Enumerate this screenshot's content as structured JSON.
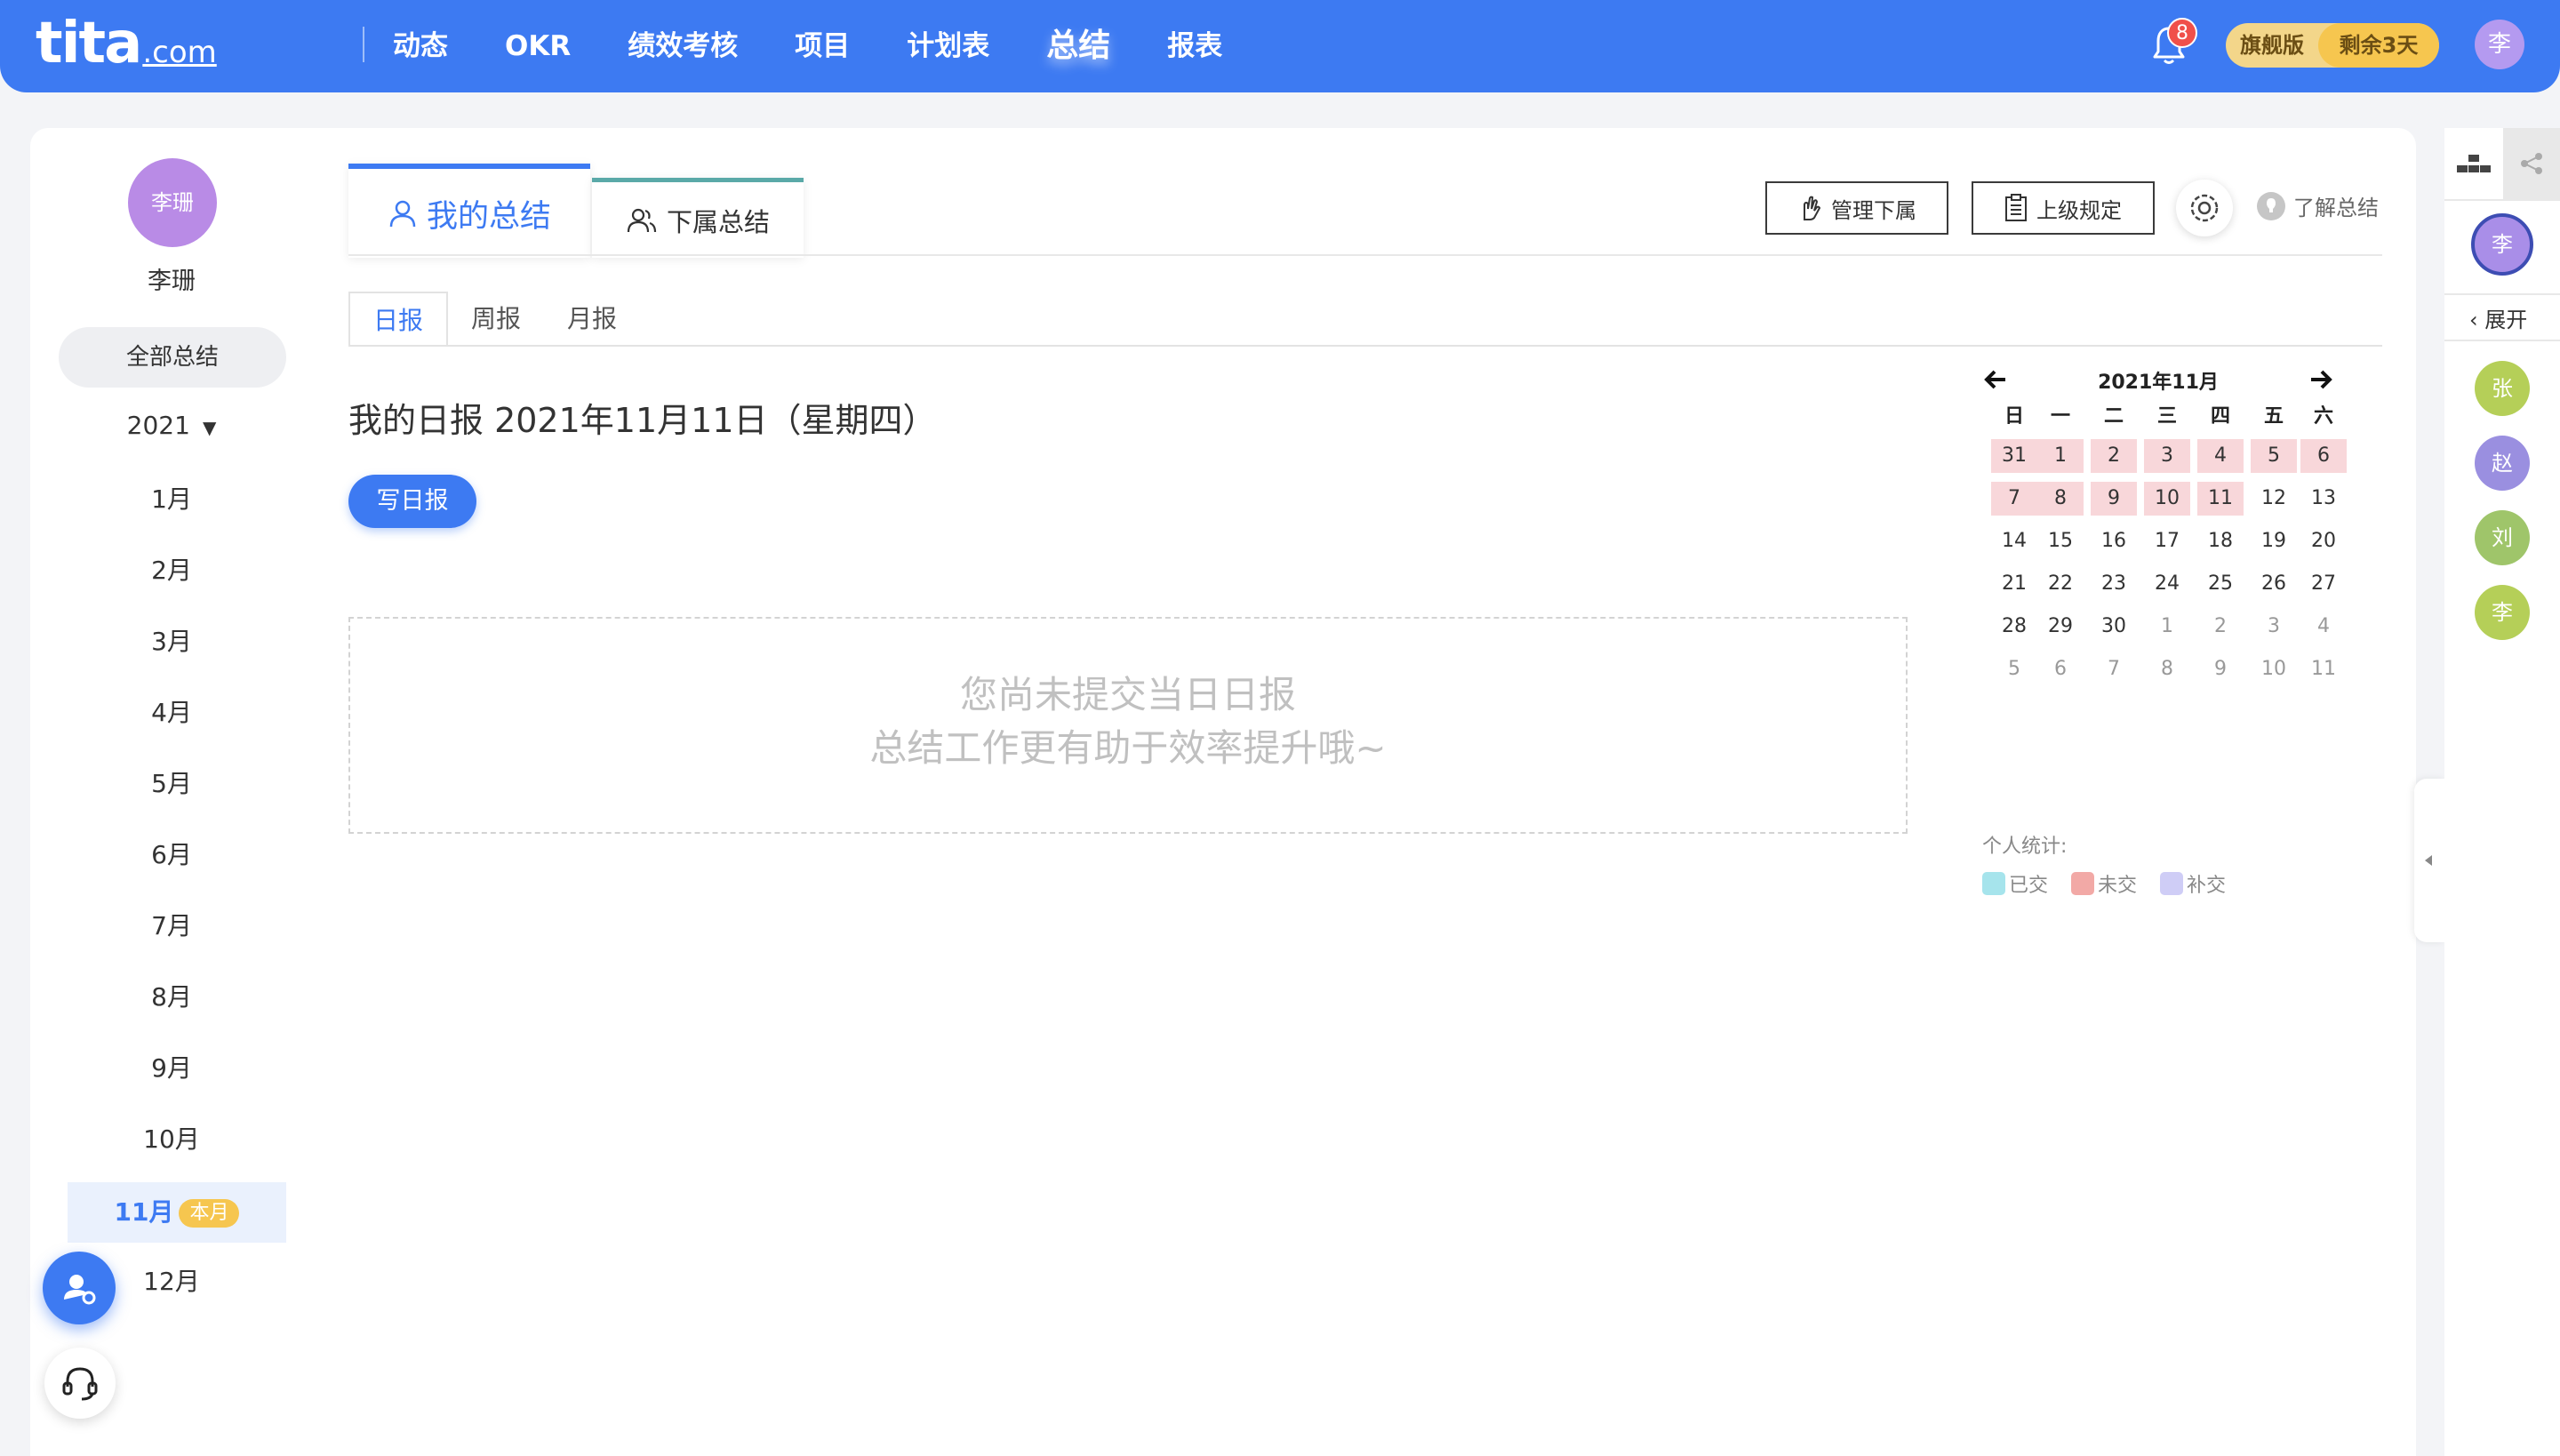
{
  "topbar": {
    "logo": "tita",
    "logo_suffix": ".com",
    "nav": [
      "动态",
      "OKR",
      "绩效考核",
      "项目",
      "计划表",
      "总结",
      "报表"
    ],
    "active_nav": "总结",
    "notification_count": "8",
    "plan_name": "旗舰版",
    "plan_remaining": "剩余3天",
    "avatar_char": "李"
  },
  "sidebar": {
    "avatar_text": "李珊",
    "name": "李珊",
    "all_summary": "全部总结",
    "year": "2021",
    "months": [
      "1月",
      "2月",
      "3月",
      "4月",
      "5月",
      "6月",
      "7月",
      "8月",
      "9月",
      "10月",
      "11月",
      "12月"
    ],
    "active_month": "11月",
    "current_badge": "本月"
  },
  "main": {
    "tab_my": "我的总结",
    "tab_sub": "下属总结",
    "btn_manage": "管理下属",
    "btn_rules": "上级规定",
    "learn": "了解总结",
    "subtabs": [
      "日报",
      "周报",
      "月报"
    ],
    "active_subtab": "日报",
    "title": "我的日报 2021年11月11日（星期四）",
    "write_button": "写日报",
    "empty_line1": "您尚未提交当日日报",
    "empty_line2": "总结工作更有助于效率提升哦~"
  },
  "calendar": {
    "title": "2021年11月",
    "weekdays": [
      "日",
      "一",
      "二",
      "三",
      "四",
      "五",
      "六"
    ],
    "weeks": [
      [
        "31",
        "1",
        "2",
        "3",
        "4",
        "5",
        "6"
      ],
      [
        "7",
        "8",
        "9",
        "10",
        "11",
        "12",
        "13"
      ],
      [
        "14",
        "15",
        "16",
        "17",
        "18",
        "19",
        "20"
      ],
      [
        "21",
        "22",
        "23",
        "24",
        "25",
        "26",
        "27"
      ],
      [
        "28",
        "29",
        "30",
        "1",
        "2",
        "3",
        "4"
      ],
      [
        "5",
        "6",
        "7",
        "8",
        "9",
        "10",
        "11"
      ]
    ],
    "missed_days": [
      "31",
      "1",
      "2",
      "3",
      "4",
      "5",
      "6",
      "7",
      "8",
      "9",
      "10",
      "11"
    ],
    "stats_label": "个人统计:",
    "legend": [
      {
        "label": "已交",
        "color": "#a6e4ec"
      },
      {
        "label": "未交",
        "color": "#f2a9a6"
      },
      {
        "label": "补交",
        "color": "#cfcdf6"
      }
    ]
  },
  "right_panel": {
    "me": "李",
    "expand": "展开",
    "members": [
      {
        "char": "张",
        "color": "#b5cf58"
      },
      {
        "char": "赵",
        "color": "#9a8fe0"
      },
      {
        "char": "刘",
        "color": "#9fc56a"
      },
      {
        "char": "李",
        "color": "#b5cf58"
      }
    ]
  },
  "colors": {
    "brand": "#3d7af2",
    "missed": "#f8d7da"
  }
}
